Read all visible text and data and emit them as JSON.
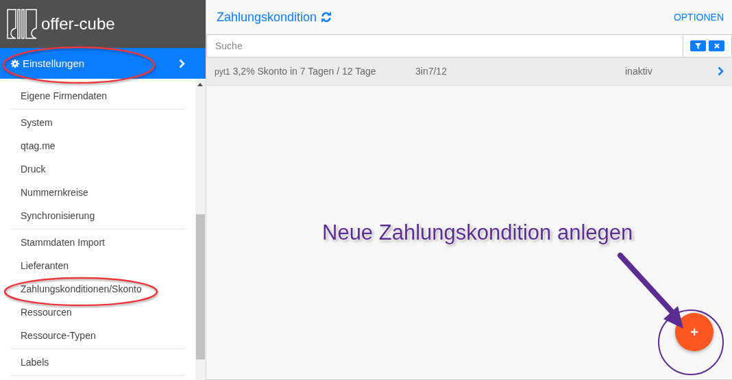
{
  "app": {
    "name": "offer-cube"
  },
  "sidebar": {
    "section": {
      "label": "Einstellungen"
    },
    "groups": [
      {
        "items": [
          {
            "label": "Eigene Firmendaten"
          }
        ]
      },
      {
        "items": [
          {
            "label": "System"
          },
          {
            "label": "qtag.me"
          },
          {
            "label": "Druck"
          },
          {
            "label": "Nummernkreise"
          },
          {
            "label": "Synchronisierung"
          }
        ]
      },
      {
        "items": [
          {
            "label": "Stammdaten Import"
          },
          {
            "label": "Lieferanten"
          },
          {
            "label": "Zahlungskonditionen/Skonto"
          },
          {
            "label": "Ressourcen"
          },
          {
            "label": "Ressource-Typen"
          }
        ]
      },
      {
        "items": [
          {
            "label": "Labels"
          }
        ]
      }
    ]
  },
  "main": {
    "title": "Zahlungskondition",
    "options": "OPTIONEN",
    "search": {
      "placeholder": "Suche"
    },
    "rows": [
      {
        "prefix": "pyt1",
        "description": "3,2% Skonto in 7 Tagen / 12 Tage",
        "code": "3in7/12",
        "status": "inaktiv"
      }
    ],
    "fab": {
      "label": "+"
    }
  },
  "annotation": {
    "text": "Neue Zahlungskondition anlegen"
  }
}
